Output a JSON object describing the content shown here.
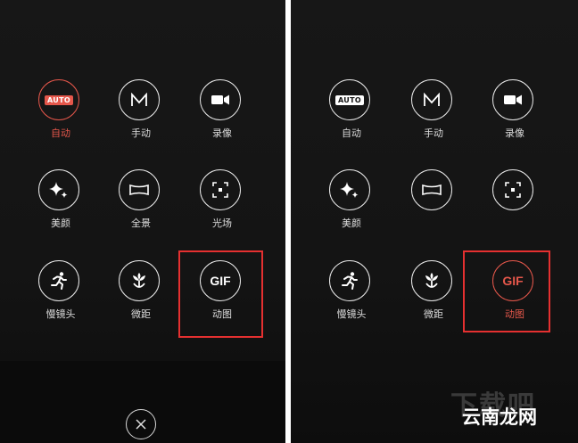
{
  "left_panel": {
    "modes": [
      {
        "label": "自动",
        "icon": "auto-icon",
        "badge": "AUTO",
        "active": true
      },
      {
        "label": "手动",
        "icon": "manual-m-icon",
        "badge": "M",
        "active": false
      },
      {
        "label": "录像",
        "icon": "video-camera-icon",
        "active": false
      },
      {
        "label": "美颜",
        "icon": "sparkle-beauty-icon",
        "active": false
      },
      {
        "label": "全景",
        "icon": "panorama-icon",
        "active": false
      },
      {
        "label": "光场",
        "icon": "light-field-focus-icon",
        "active": false
      },
      {
        "label": "慢镜头",
        "icon": "running-person-icon",
        "active": false
      },
      {
        "label": "微距",
        "icon": "flower-macro-icon",
        "active": false
      },
      {
        "label": "动图",
        "icon": "gif-icon",
        "badge": "GIF",
        "active": false
      }
    ]
  },
  "right_panel": {
    "modes": [
      {
        "label": "自动",
        "icon": "auto-icon",
        "badge": "AUTO",
        "active": false
      },
      {
        "label": "手动",
        "icon": "manual-m-icon",
        "badge": "M",
        "active": false
      },
      {
        "label": "录像",
        "icon": "video-camera-icon",
        "active": false
      },
      {
        "label": "美颜",
        "icon": "sparkle-beauty-icon",
        "active": false
      },
      {
        "label": "",
        "icon": "panorama-icon",
        "active": false
      },
      {
        "label": "",
        "icon": "light-field-focus-icon",
        "active": false
      },
      {
        "label": "慢镜头",
        "icon": "running-person-icon",
        "active": false
      },
      {
        "label": "微距",
        "icon": "flower-macro-icon",
        "active": false
      },
      {
        "label": "动图",
        "icon": "gif-icon",
        "badge": "GIF",
        "active": true
      }
    ]
  },
  "footer": {
    "close_icon": "close-x-icon"
  },
  "watermark": {
    "big": "下载吧",
    "brand": "云南龙网"
  },
  "colors": {
    "accent": "#e5574b",
    "highlight_box": "#e53030",
    "background": "#151515",
    "icon_stroke": "#e9e9e9"
  }
}
